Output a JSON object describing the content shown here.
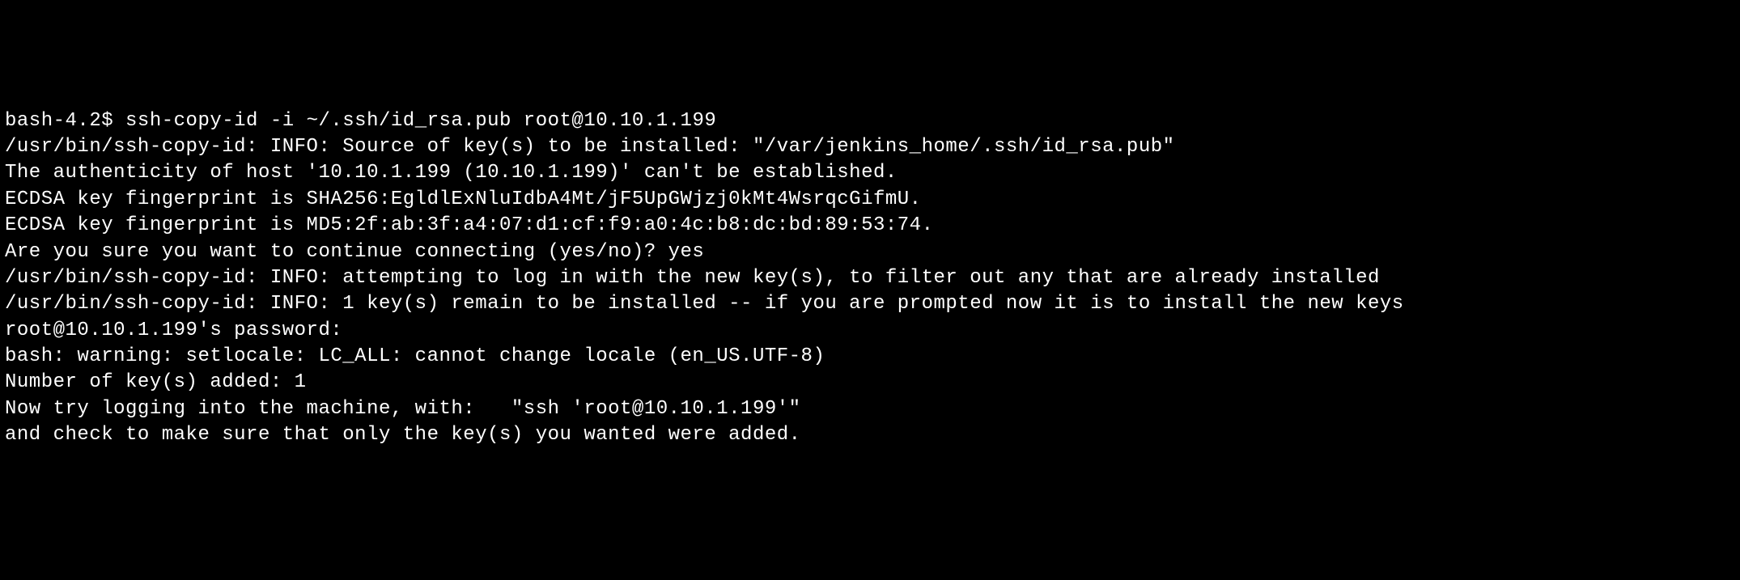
{
  "terminal": {
    "lines": [
      {
        "prompt": "bash-4.2$ ",
        "command": "ssh-copy-id -i ~/.ssh/id_rsa.pub root@10.10.1.199"
      },
      {
        "text": "/usr/bin/ssh-copy-id: INFO: Source of key(s) to be installed: \"/var/jenkins_home/.ssh/id_rsa.pub\""
      },
      {
        "text": "The authenticity of host '10.10.1.199 (10.10.1.199)' can't be established."
      },
      {
        "text": "ECDSA key fingerprint is SHA256:EgldlExNluIdbA4Mt/jF5UpGWjzj0kMt4WsrqcGifmU."
      },
      {
        "text": "ECDSA key fingerprint is MD5:2f:ab:3f:a4:07:d1:cf:f9:a0:4c:b8:dc:bd:89:53:74."
      },
      {
        "text": "Are you sure you want to continue connecting (yes/no)? yes"
      },
      {
        "text": "/usr/bin/ssh-copy-id: INFO: attempting to log in with the new key(s), to filter out any that are already installed"
      },
      {
        "text": "/usr/bin/ssh-copy-id: INFO: 1 key(s) remain to be installed -- if you are prompted now it is to install the new keys"
      },
      {
        "text": "root@10.10.1.199's password:"
      },
      {
        "text": "bash: warning: setlocale: LC_ALL: cannot change locale (en_US.UTF-8)"
      },
      {
        "text": ""
      },
      {
        "text": "Number of key(s) added: 1"
      },
      {
        "text": ""
      },
      {
        "text": "Now try logging into the machine, with:   \"ssh 'root@10.10.1.199'\""
      },
      {
        "text": "and check to make sure that only the key(s) you wanted were added."
      }
    ]
  }
}
